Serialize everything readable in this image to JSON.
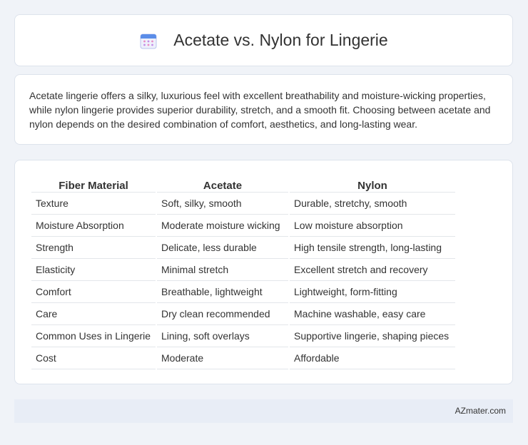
{
  "header": {
    "title": "Acetate vs. Nylon for Lingerie",
    "icon": "calendar-icon"
  },
  "intro": {
    "text": "Acetate lingerie offers a silky, luxurious feel with excellent breathability and moisture-wicking properties, while nylon lingerie provides superior durability, stretch, and a smooth fit. Choosing between acetate and nylon depends on the desired combination of comfort, aesthetics, and long-lasting wear."
  },
  "table": {
    "headers": [
      "Fiber Material",
      "Acetate",
      "Nylon"
    ],
    "rows": [
      [
        "Texture",
        "Soft, silky, smooth",
        "Durable, stretchy, smooth"
      ],
      [
        "Moisture Absorption",
        "Moderate moisture wicking",
        "Low moisture absorption"
      ],
      [
        "Strength",
        "Delicate, less durable",
        "High tensile strength, long-lasting"
      ],
      [
        "Elasticity",
        "Minimal stretch",
        "Excellent stretch and recovery"
      ],
      [
        "Comfort",
        "Breathable, lightweight",
        "Lightweight, form-fitting"
      ],
      [
        "Care",
        "Dry clean recommended",
        "Machine washable, easy care"
      ],
      [
        "Common Uses in Lingerie",
        "Lining, soft overlays",
        "Supportive lingerie, shaping pieces"
      ],
      [
        "Cost",
        "Moderate",
        "Affordable"
      ]
    ]
  },
  "footer": {
    "site": "AZmater.com"
  }
}
